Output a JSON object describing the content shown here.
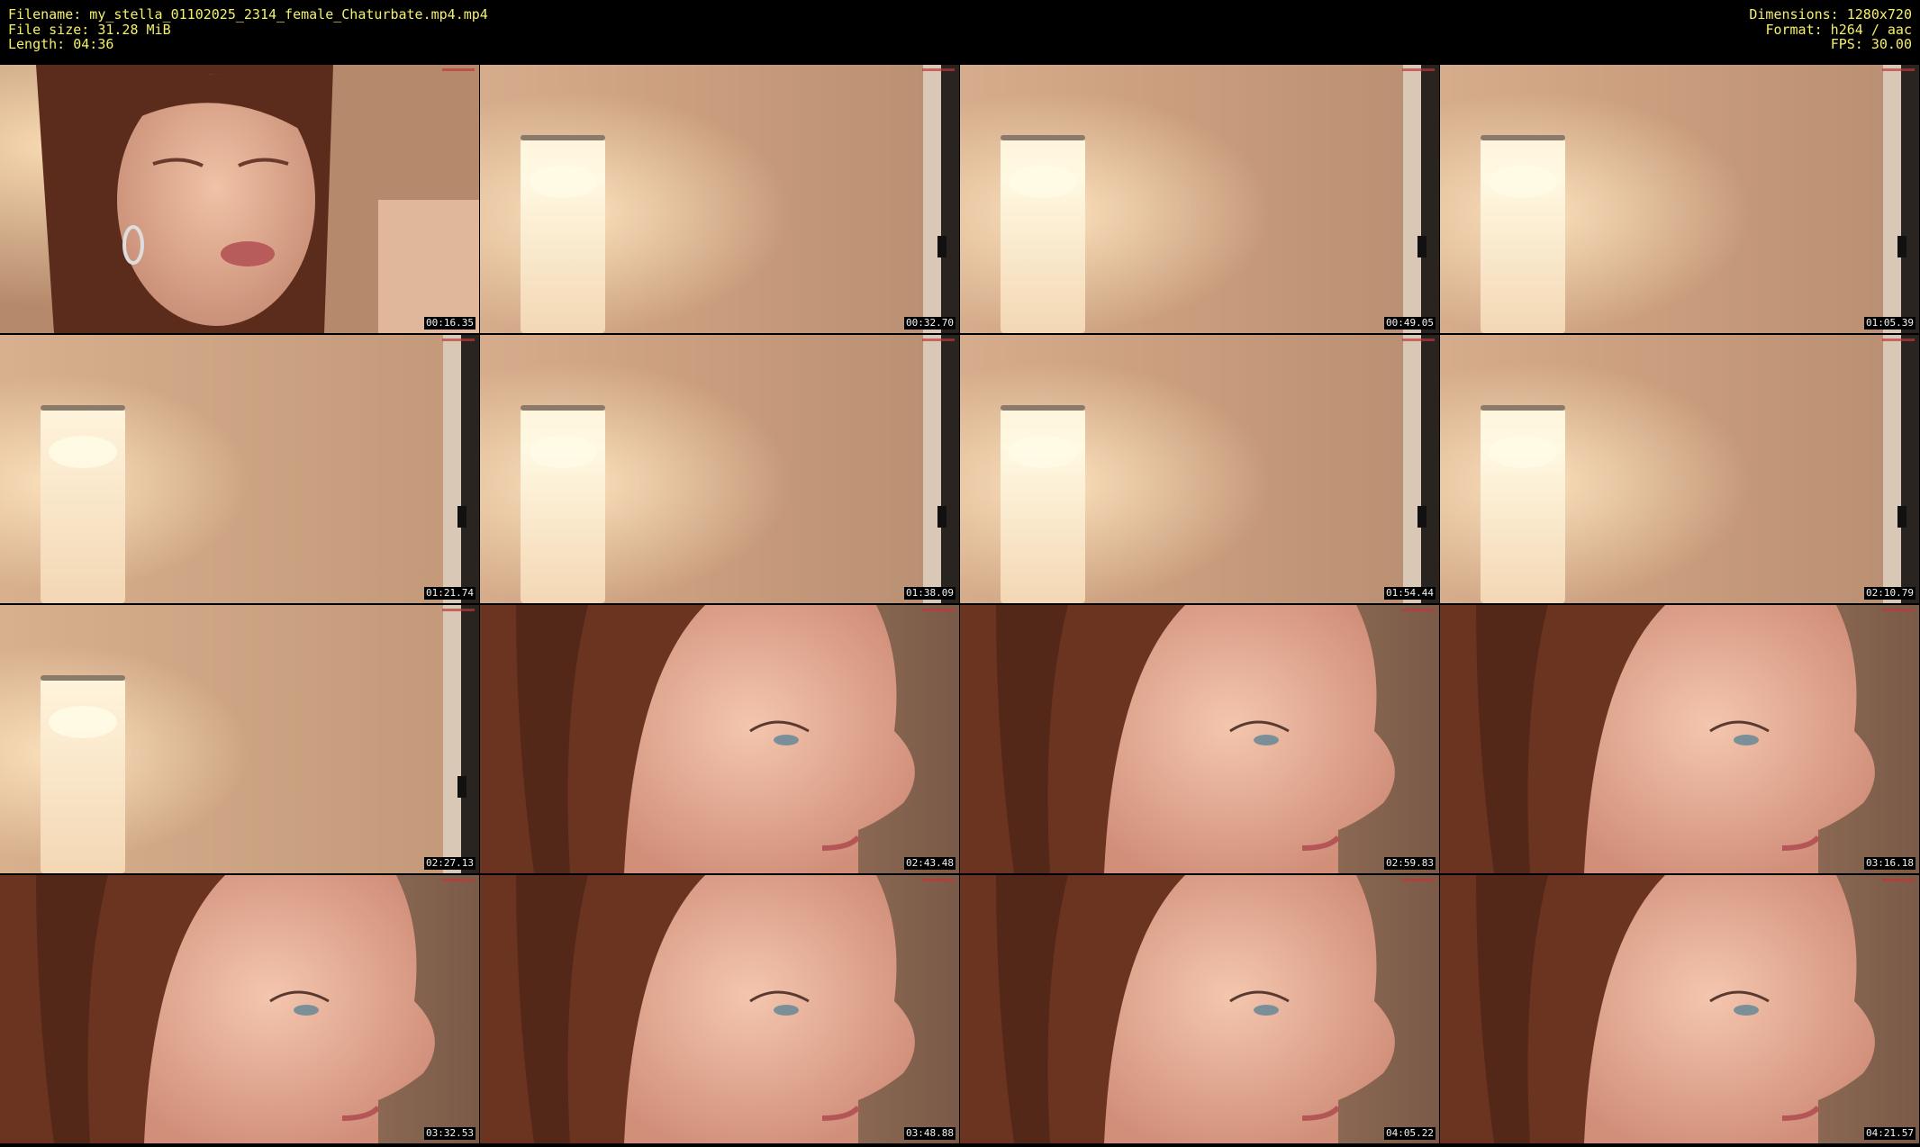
{
  "header": {
    "filename": "Filename: my_stella_01102025_2314_female_Chaturbate.mp4.mp4",
    "filesize": "File size: 31.28 MiB",
    "length": "Length: 04:36",
    "dimensions": "Dimensions: 1280x720",
    "format": "Format: h264 / aac",
    "fps": "FPS: 30.00"
  },
  "thumbnails": [
    {
      "time": "00:16.35",
      "scene": "face-front"
    },
    {
      "time": "00:32.70",
      "scene": "lamp"
    },
    {
      "time": "00:49.05",
      "scene": "lamp"
    },
    {
      "time": "01:05.39",
      "scene": "lamp"
    },
    {
      "time": "01:21.74",
      "scene": "lamp-left"
    },
    {
      "time": "01:38.09",
      "scene": "lamp"
    },
    {
      "time": "01:54.44",
      "scene": "lamp"
    },
    {
      "time": "02:10.79",
      "scene": "lamp"
    },
    {
      "time": "02:27.13",
      "scene": "lamp-left"
    },
    {
      "time": "02:43.48",
      "scene": "face-profile"
    },
    {
      "time": "02:59.83",
      "scene": "face-profile"
    },
    {
      "time": "03:16.18",
      "scene": "face-profile"
    },
    {
      "time": "03:32.53",
      "scene": "face-profile"
    },
    {
      "time": "03:48.88",
      "scene": "face-profile"
    },
    {
      "time": "04:05.22",
      "scene": "face-profile"
    },
    {
      "time": "04:21.57",
      "scene": "face-profile"
    }
  ]
}
